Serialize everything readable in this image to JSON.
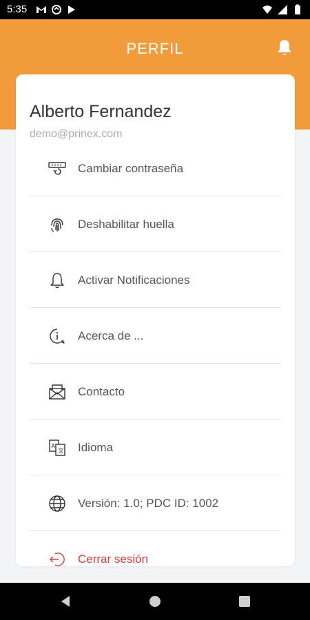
{
  "status_bar": {
    "time": "5:35",
    "notification_icons": [
      "gmail-icon",
      "sync-icon",
      "play-store-icon"
    ],
    "system_icons": [
      "wifi-icon",
      "cell-signal-icon",
      "battery-icon"
    ]
  },
  "header": {
    "title": "PERFIL",
    "background": "#f29b3a",
    "action_icon": "bell-icon"
  },
  "profile": {
    "name": "Alberto Fernandez",
    "email": "demo@prinex.com"
  },
  "menu": {
    "items": [
      {
        "label": "Cambiar contraseña",
        "icon": "password-reset-icon"
      },
      {
        "label": "Deshabilitar huella",
        "icon": "fingerprint-icon"
      },
      {
        "label": "Activar Notificaciones",
        "icon": "bell-icon"
      },
      {
        "label": "Acerca de ...",
        "icon": "info-icon"
      },
      {
        "label": "Contacto",
        "icon": "mail-icon"
      },
      {
        "label": "Idioma",
        "icon": "language-icon"
      },
      {
        "label": "Versión: 1.0; PDC ID: 1002",
        "icon": "globe-icon"
      },
      {
        "label": "Cerrar sesión",
        "icon": "logout-icon",
        "color": "#e53935"
      }
    ]
  },
  "nav_bar": {
    "buttons": [
      "back-icon",
      "home-icon",
      "recents-icon"
    ]
  }
}
